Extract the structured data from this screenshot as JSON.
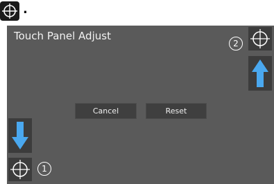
{
  "indicator": {
    "dot": "."
  },
  "panel": {
    "title": "Touch Panel Adjust",
    "buttons": {
      "cancel": "Cancel",
      "reset": "Reset"
    }
  },
  "markers": {
    "step_1": "1",
    "step_2": "2"
  },
  "icons": {
    "target": "crosshair-target-icon",
    "arrow_up": "arrow-up-icon",
    "arrow_down": "arrow-down-icon"
  },
  "colors": {
    "panel_bg": "#5a5a5a",
    "button_bg": "#3f3f3f",
    "arrow_blue": "#4aa8ef",
    "text": "#f2f2f2"
  }
}
